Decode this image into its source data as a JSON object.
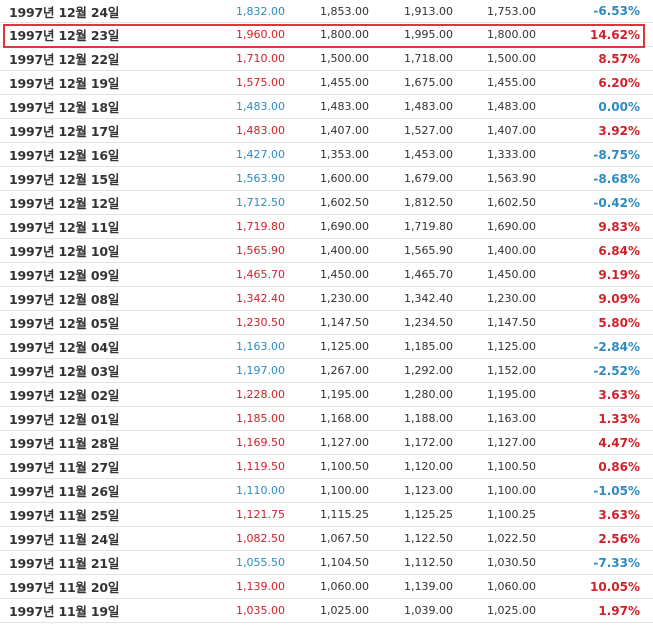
{
  "colors": {
    "up": "#d2202b",
    "down": "#2d8bc0",
    "highlight_border": "#e2343b",
    "row_divider": "#e4e4e4"
  },
  "rows": [
    {
      "date": "1997년 12월 24일",
      "close": "1,832.00",
      "open": "1,853.00",
      "high": "1,913.00",
      "low": "1,753.00",
      "change": "-6.53%",
      "dir": "down"
    },
    {
      "date": "1997년 12월 23일",
      "close": "1,960.00",
      "open": "1,800.00",
      "high": "1,995.00",
      "low": "1,800.00",
      "change": "14.62%",
      "dir": "up"
    },
    {
      "date": "1997년 12월 22일",
      "close": "1,710.00",
      "open": "1,500.00",
      "high": "1,718.00",
      "low": "1,500.00",
      "change": "8.57%",
      "dir": "up"
    },
    {
      "date": "1997년 12월 19일",
      "close": "1,575.00",
      "open": "1,455.00",
      "high": "1,675.00",
      "low": "1,455.00",
      "change": "6.20%",
      "dir": "up"
    },
    {
      "date": "1997년 12월 18일",
      "close": "1,483.00",
      "open": "1,483.00",
      "high": "1,483.00",
      "low": "1,483.00",
      "change": "0.00%",
      "dir": "down"
    },
    {
      "date": "1997년 12월 17일",
      "close": "1,483.00",
      "open": "1,407.00",
      "high": "1,527.00",
      "low": "1,407.00",
      "change": "3.92%",
      "dir": "up"
    },
    {
      "date": "1997년 12월 16일",
      "close": "1,427.00",
      "open": "1,353.00",
      "high": "1,453.00",
      "low": "1,333.00",
      "change": "-8.75%",
      "dir": "down"
    },
    {
      "date": "1997년 12월 15일",
      "close": "1,563.90",
      "open": "1,600.00",
      "high": "1,679.00",
      "low": "1,563.90",
      "change": "-8.68%",
      "dir": "down"
    },
    {
      "date": "1997년 12월 12일",
      "close": "1,712.50",
      "open": "1,602.50",
      "high": "1,812.50",
      "low": "1,602.50",
      "change": "-0.42%",
      "dir": "down"
    },
    {
      "date": "1997년 12월 11일",
      "close": "1,719.80",
      "open": "1,690.00",
      "high": "1,719.80",
      "low": "1,690.00",
      "change": "9.83%",
      "dir": "up"
    },
    {
      "date": "1997년 12월 10일",
      "close": "1,565.90",
      "open": "1,400.00",
      "high": "1,565.90",
      "low": "1,400.00",
      "change": "6.84%",
      "dir": "up"
    },
    {
      "date": "1997년 12월 09일",
      "close": "1,465.70",
      "open": "1,450.00",
      "high": "1,465.70",
      "low": "1,450.00",
      "change": "9.19%",
      "dir": "up"
    },
    {
      "date": "1997년 12월 08일",
      "close": "1,342.40",
      "open": "1,230.00",
      "high": "1,342.40",
      "low": "1,230.00",
      "change": "9.09%",
      "dir": "up"
    },
    {
      "date": "1997년 12월 05일",
      "close": "1,230.50",
      "open": "1,147.50",
      "high": "1,234.50",
      "low": "1,147.50",
      "change": "5.80%",
      "dir": "up"
    },
    {
      "date": "1997년 12월 04일",
      "close": "1,163.00",
      "open": "1,125.00",
      "high": "1,185.00",
      "low": "1,125.00",
      "change": "-2.84%",
      "dir": "down"
    },
    {
      "date": "1997년 12월 03일",
      "close": "1,197.00",
      "open": "1,267.00",
      "high": "1,292.00",
      "low": "1,152.00",
      "change": "-2.52%",
      "dir": "down"
    },
    {
      "date": "1997년 12월 02일",
      "close": "1,228.00",
      "open": "1,195.00",
      "high": "1,280.00",
      "low": "1,195.00",
      "change": "3.63%",
      "dir": "up"
    },
    {
      "date": "1997년 12월 01일",
      "close": "1,185.00",
      "open": "1,168.00",
      "high": "1,188.00",
      "low": "1,163.00",
      "change": "1.33%",
      "dir": "up"
    },
    {
      "date": "1997년 11월 28일",
      "close": "1,169.50",
      "open": "1,127.00",
      "high": "1,172.00",
      "low": "1,127.00",
      "change": "4.47%",
      "dir": "up"
    },
    {
      "date": "1997년 11월 27일",
      "close": "1,119.50",
      "open": "1,100.50",
      "high": "1,120.00",
      "low": "1,100.50",
      "change": "0.86%",
      "dir": "up"
    },
    {
      "date": "1997년 11월 26일",
      "close": "1,110.00",
      "open": "1,100.00",
      "high": "1,123.00",
      "low": "1,100.00",
      "change": "-1.05%",
      "dir": "down"
    },
    {
      "date": "1997년 11월 25일",
      "close": "1,121.75",
      "open": "1,115.25",
      "high": "1,125.25",
      "low": "1,100.25",
      "change": "3.63%",
      "dir": "up"
    },
    {
      "date": "1997년 11월 24일",
      "close": "1,082.50",
      "open": "1,067.50",
      "high": "1,122.50",
      "low": "1,022.50",
      "change": "2.56%",
      "dir": "up"
    },
    {
      "date": "1997년 11월 21일",
      "close": "1,055.50",
      "open": "1,104.50",
      "high": "1,112.50",
      "low": "1,030.50",
      "change": "-7.33%",
      "dir": "down"
    },
    {
      "date": "1997년 11월 20일",
      "close": "1,139.00",
      "open": "1,060.00",
      "high": "1,139.00",
      "low": "1,060.00",
      "change": "10.05%",
      "dir": "up"
    },
    {
      "date": "1997년 11월 19일",
      "close": "1,035.00",
      "open": "1,025.00",
      "high": "1,039.00",
      "low": "1,025.00",
      "change": "1.97%",
      "dir": "up"
    }
  ],
  "highlighted_row_index": 1
}
